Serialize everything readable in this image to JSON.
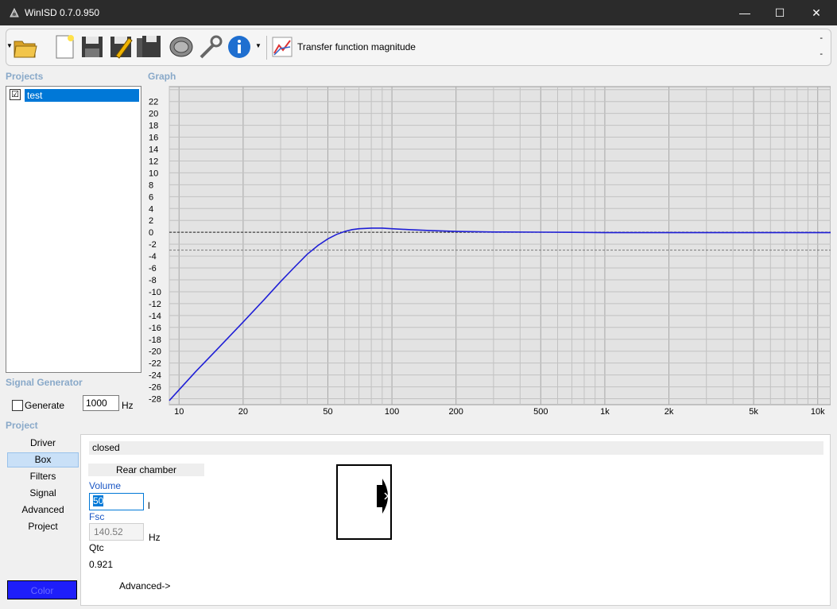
{
  "window": {
    "title": "WinISD 0.7.0.950",
    "min_symbol": "—",
    "max_symbol": "☐",
    "close_symbol": "✕"
  },
  "toolbar": {
    "buttons": [
      "open-folder-icon",
      "new-file-icon",
      "save-icon",
      "save-as-icon",
      "save-all-icon",
      "driver-icon",
      "tools-icon",
      "info-icon"
    ],
    "graph_label": "Transfer function magnitude",
    "dash_top": "-",
    "dash_bottom": "-"
  },
  "projects": {
    "header": "Projects",
    "items": [
      {
        "label": "test",
        "checked": "☑"
      }
    ]
  },
  "graph": {
    "header": "Graph"
  },
  "signal_generator": {
    "header": "Signal Generator",
    "generate_label": "Generate",
    "frequency": "1000",
    "unit": "Hz"
  },
  "project_nav": {
    "header": "Project",
    "items": [
      "Driver",
      "Box",
      "Filters",
      "Signal",
      "Advanced",
      "Project"
    ],
    "active": "Box",
    "color_button": "Color"
  },
  "box_panel": {
    "type": "closed",
    "rear_chamber": "Rear chamber",
    "volume_label": "Volume",
    "volume_value": "50",
    "volume_unit": "l",
    "fsc_label": "Fsc",
    "fsc_value": "140.52",
    "fsc_unit": "Hz",
    "qtc_label": "Qtc",
    "qtc_value": "0.921",
    "advanced_link": "Advanced->"
  },
  "chart_data": {
    "type": "line",
    "xscale": "log",
    "xlim": [
      9,
      11500
    ],
    "ylim": [
      -29,
      24.5
    ],
    "x_ticks": [
      10,
      20,
      50,
      100,
      200,
      500,
      1000,
      2000,
      5000,
      10000
    ],
    "x_tick_labels": [
      "10",
      "20",
      "50",
      "100",
      "200",
      "500",
      "1k",
      "2k",
      "5k",
      "10k"
    ],
    "y_ticks": [
      22,
      20,
      18,
      16,
      14,
      12,
      10,
      8,
      6,
      4,
      2,
      0,
      -2,
      -4,
      -6,
      -8,
      -10,
      -12,
      -14,
      -16,
      -18,
      -20,
      -22,
      -24,
      -26,
      -28
    ],
    "y_tick_labels": [
      "22",
      "20",
      "18",
      "16",
      "14",
      "12",
      "10",
      "8",
      "6",
      "4",
      "2",
      "0",
      "-2",
      "-4",
      "-6",
      "-8",
      "-10",
      "-12",
      "-14",
      "-16",
      "-18",
      "-20",
      "-22",
      "-24",
      "-26",
      "-28"
    ],
    "reference_lines": [
      0,
      -3
    ],
    "grid": true,
    "series": [
      {
        "color": "#1f1fd6",
        "x": [
          9,
          10,
          12,
          15,
          20,
          25,
          30,
          35,
          40,
          45,
          50,
          55,
          60,
          65,
          70,
          80,
          90,
          100,
          120,
          150,
          200,
          300,
          500,
          700,
          1000,
          2000,
          5000,
          11500
        ],
        "y": [
          -28.3,
          -26.5,
          -23.4,
          -19.8,
          -15.1,
          -11.4,
          -8.3,
          -5.8,
          -3.7,
          -2.2,
          -1.1,
          -0.35,
          0.15,
          0.45,
          0.6,
          0.7,
          0.7,
          0.6,
          0.45,
          0.3,
          0.15,
          0.05,
          0.02,
          0.0,
          -0.05,
          -0.05,
          -0.05,
          -0.05
        ]
      }
    ]
  }
}
